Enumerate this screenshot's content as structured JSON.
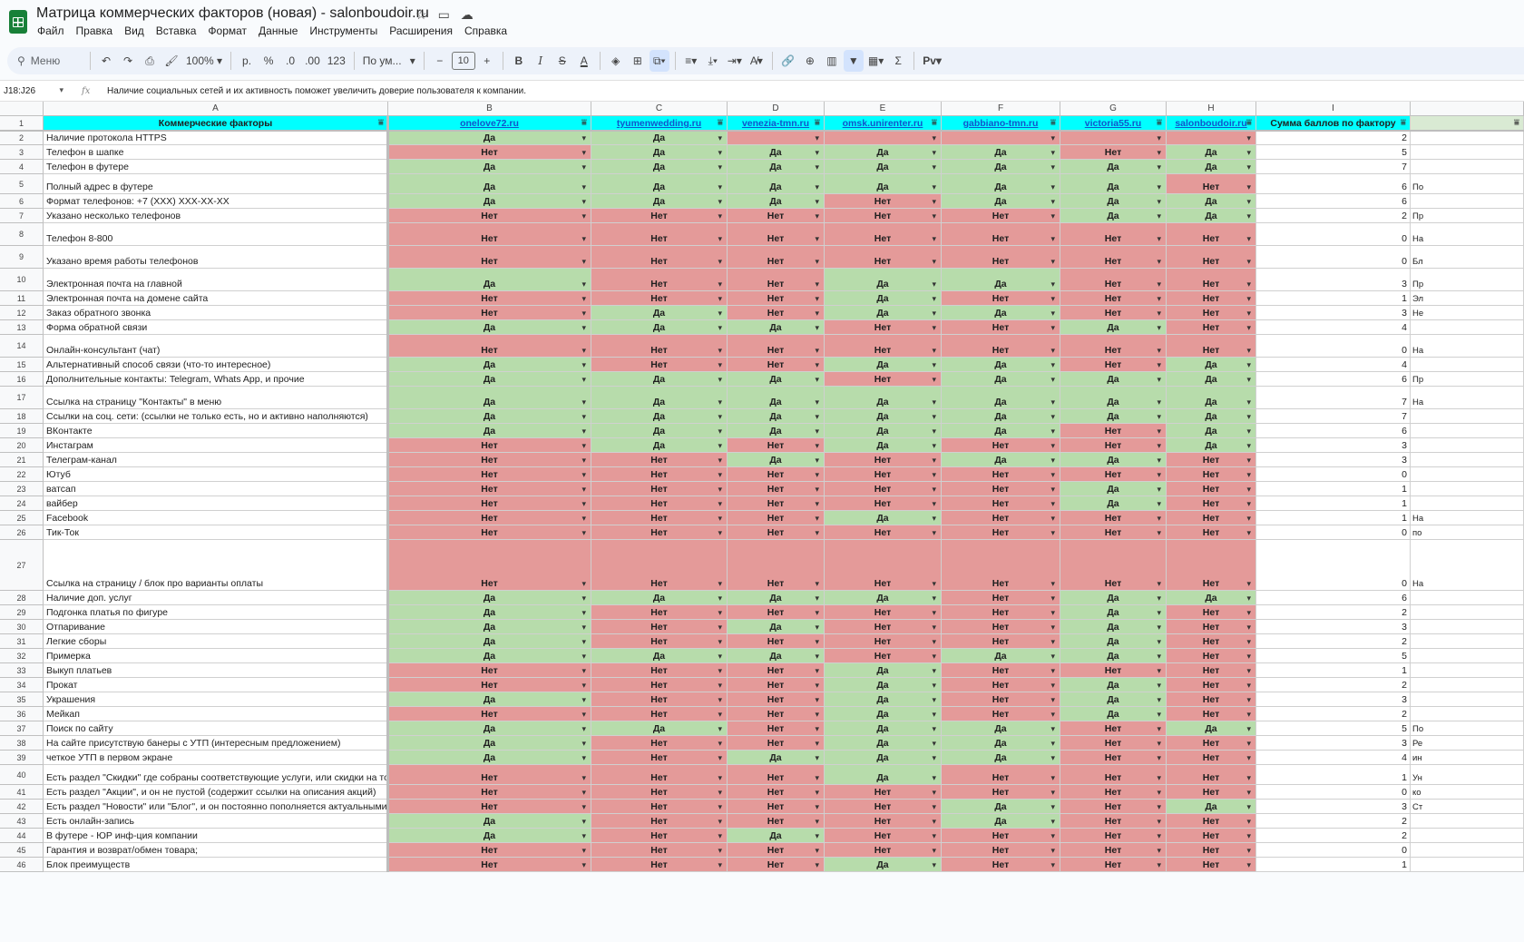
{
  "app": {
    "title": "Матрица коммерческих факторов (новая) - salonboudoir.ru",
    "menu": [
      "Файл",
      "Правка",
      "Вид",
      "Вставка",
      "Формат",
      "Данные",
      "Инструменты",
      "Расширения",
      "Справка"
    ]
  },
  "toolbar": {
    "search_label": "Меню",
    "zoom": "100%",
    "currency": "р.",
    "percent": "%",
    "dec_less": ".0",
    "dec_more": ".00",
    "format_num": "123",
    "font": "По ум...",
    "font_size": "10",
    "bold": "B",
    "italic": "I",
    "strike": "S",
    "text_color": "A",
    "sigma": "Σ",
    "input_tool": "Pv"
  },
  "formula_bar": {
    "name_box": "J18:J26",
    "fx": "fx",
    "content": "Наличие социальных сетей и их активность поможет увеличить доверие пользователя к компании."
  },
  "columns": [
    "",
    "A",
    "B",
    "C",
    "D",
    "E",
    "F",
    "G",
    "H",
    "I"
  ],
  "headers": {
    "factor": "Коммерческие факторы",
    "sites": [
      "onelove72.ru",
      "tyumenwedding.ru",
      "venezia-tmn.ru",
      "omsk.unirenter.ru",
      "gabbiano-tmn.ru",
      "victoria55.ru",
      "salonboudoir.ru"
    ],
    "sum": "Сумма баллов по фактору"
  },
  "rows": [
    {
      "n": "2",
      "f": "Наличие протокола HTTPS",
      "v": [
        "Да",
        "Да",
        "",
        "",
        "",
        "",
        ""
      ],
      "s": "2",
      "j": ""
    },
    {
      "n": "3",
      "f": "Телефон в шапке",
      "v": [
        "Нет",
        "Да",
        "Да",
        "Да",
        "Да",
        "Нет",
        "Да"
      ],
      "s": "5",
      "j": ""
    },
    {
      "n": "4",
      "f": "Телефон в футере",
      "v": [
        "Да",
        "Да",
        "Да",
        "Да",
        "Да",
        "Да",
        "Да"
      ],
      "s": "7",
      "j": ""
    },
    {
      "n": "5",
      "f": "Полный адрес в футере",
      "v": [
        "Да",
        "Да",
        "Да",
        "Да",
        "Да",
        "Да",
        "Нет"
      ],
      "s": "6",
      "j": "По"
    },
    {
      "n": "6",
      "f": "Формат телефонов: +7 (XXX) XXX-XX-XX",
      "v": [
        "Да",
        "Да",
        "Да",
        "Нет",
        "Да",
        "Да",
        "Да"
      ],
      "s": "6",
      "j": ""
    },
    {
      "n": "7",
      "f": "Указано несколько телефонов",
      "v": [
        "Нет",
        "Нет",
        "Нет",
        "Нет",
        "Нет",
        "Да",
        "Да"
      ],
      "s": "2",
      "j": "Пр"
    },
    {
      "n": "8",
      "f": "Телефон 8-800",
      "v": [
        "Нет",
        "Нет",
        "Нет",
        "Нет",
        "Нет",
        "Нет",
        "Нет"
      ],
      "s": "0",
      "j": "На"
    },
    {
      "n": "9",
      "f": "Указано время работы телефонов",
      "v": [
        "Нет",
        "Нет",
        "Нет",
        "Нет",
        "Нет",
        "Нет",
        "Нет"
      ],
      "s": "0",
      "j": "Бл"
    },
    {
      "n": "10",
      "f": "Электронная почта на главной",
      "v": [
        "Да",
        "Нет",
        "Нет",
        "Да",
        "Да",
        "Нет",
        "Нет"
      ],
      "s": "3",
      "j": "Пр"
    },
    {
      "n": "11",
      "f": "Электронная почта на домене сайта",
      "v": [
        "Нет",
        "Нет",
        "Нет",
        "Да",
        "Нет",
        "Нет",
        "Нет"
      ],
      "s": "1",
      "j": "Эл"
    },
    {
      "n": "12",
      "f": "Заказ обратного звонка",
      "v": [
        "Нет",
        "Да",
        "Нет",
        "Да",
        "Да",
        "Нет",
        "Нет"
      ],
      "s": "3",
      "j": "Не"
    },
    {
      "n": "13",
      "f": "Форма обратной связи",
      "v": [
        "Да",
        "Да",
        "Да",
        "Нет",
        "Нет",
        "Да",
        "Нет"
      ],
      "s": "4",
      "j": ""
    },
    {
      "n": "14",
      "f": "Онлайн-консультант (чат)",
      "v": [
        "Нет",
        "Нет",
        "Нет",
        "Нет",
        "Нет",
        "Нет",
        "Нет"
      ],
      "s": "0",
      "j": "На"
    },
    {
      "n": "15",
      "f": "Альтернативный способ связи (что-то интересное)",
      "v": [
        "Да",
        "Нет",
        "Нет",
        "Да",
        "Да",
        "Нет",
        "Да"
      ],
      "s": "4",
      "j": ""
    },
    {
      "n": "16",
      "f": "Дополнительные контакты: Telegram, Whats App, и прочие",
      "v": [
        "Да",
        "Да",
        "Да",
        "Нет",
        "Да",
        "Да",
        "Да"
      ],
      "s": "6",
      "j": "Пр"
    },
    {
      "n": "17",
      "f": "Ссылка на страницу \"Контакты\" в меню",
      "v": [
        "Да",
        "Да",
        "Да",
        "Да",
        "Да",
        "Да",
        "Да"
      ],
      "s": "7",
      "j": "На"
    },
    {
      "n": "18",
      "f": "Ссылки на соц. сети: (ссылки не только есть, но и активно наполняются)",
      "v": [
        "Да",
        "Да",
        "Да",
        "Да",
        "Да",
        "Да",
        "Да"
      ],
      "s": "7",
      "j": ""
    },
    {
      "n": "19",
      "f": "ВКонтакте",
      "v": [
        "Да",
        "Да",
        "Да",
        "Да",
        "Да",
        "Нет",
        "Да"
      ],
      "s": "6",
      "j": ""
    },
    {
      "n": "20",
      "f": "Инстаграм",
      "v": [
        "Нет",
        "Да",
        "Нет",
        "Да",
        "Нет",
        "Нет",
        "Да"
      ],
      "s": "3",
      "j": ""
    },
    {
      "n": "21",
      "f": "Телеграм-канал",
      "v": [
        "Нет",
        "Нет",
        "Да",
        "Нет",
        "Да",
        "Да",
        "Нет"
      ],
      "s": "3",
      "j": ""
    },
    {
      "n": "22",
      "f": "Ютуб",
      "v": [
        "Нет",
        "Нет",
        "Нет",
        "Нет",
        "Нет",
        "Нет",
        "Нет"
      ],
      "s": "0",
      "j": ""
    },
    {
      "n": "23",
      "f": "ватсап",
      "v": [
        "Нет",
        "Нет",
        "Нет",
        "Нет",
        "Нет",
        "Да",
        "Нет"
      ],
      "s": "1",
      "j": ""
    },
    {
      "n": "24",
      "f": "вайбер",
      "v": [
        "Нет",
        "Нет",
        "Нет",
        "Нет",
        "Нет",
        "Да",
        "Нет"
      ],
      "s": "1",
      "j": ""
    },
    {
      "n": "25",
      "f": "Facebook",
      "v": [
        "Нет",
        "Нет",
        "Нет",
        "Да",
        "Нет",
        "Нет",
        "Нет"
      ],
      "s": "1",
      "j": "На"
    },
    {
      "n": "26",
      "f": "Тик-Ток",
      "v": [
        "Нет",
        "Нет",
        "Нет",
        "Нет",
        "Нет",
        "Нет",
        "Нет"
      ],
      "s": "0",
      "j": "по"
    },
    {
      "n": "27",
      "f": "Ссылка на страницу / блок про варианты оплаты",
      "v": [
        "Нет",
        "Нет",
        "Нет",
        "Нет",
        "Нет",
        "Нет",
        "Нет"
      ],
      "s": "0",
      "j": "На"
    },
    {
      "n": "28",
      "f": "Наличие доп. услуг",
      "v": [
        "Да",
        "Да",
        "Да",
        "Да",
        "Нет",
        "Да",
        "Да"
      ],
      "s": "6",
      "j": ""
    },
    {
      "n": "29",
      "f": "Подгонка платья по фигуре",
      "v": [
        "Да",
        "Нет",
        "Нет",
        "Нет",
        "Нет",
        "Да",
        "Нет"
      ],
      "s": "2",
      "j": ""
    },
    {
      "n": "30",
      "f": "Отпаривание",
      "v": [
        "Да",
        "Нет",
        "Да",
        "Нет",
        "Нет",
        "Да",
        "Нет"
      ],
      "s": "3",
      "j": ""
    },
    {
      "n": "31",
      "f": "Легкие сборы",
      "v": [
        "Да",
        "Нет",
        "Нет",
        "Нет",
        "Нет",
        "Да",
        "Нет"
      ],
      "s": "2",
      "j": ""
    },
    {
      "n": "32",
      "f": "Примерка",
      "v": [
        "Да",
        "Да",
        "Да",
        "Нет",
        "Да",
        "Да",
        "Нет"
      ],
      "s": "5",
      "j": ""
    },
    {
      "n": "33",
      "f": "Выкуп платьев",
      "v": [
        "Нет",
        "Нет",
        "Нет",
        "Да",
        "Нет",
        "Нет",
        "Нет"
      ],
      "s": "1",
      "j": ""
    },
    {
      "n": "34",
      "f": "Прокат",
      "v": [
        "Нет",
        "Нет",
        "Нет",
        "Да",
        "Нет",
        "Да",
        "Нет"
      ],
      "s": "2",
      "j": ""
    },
    {
      "n": "35",
      "f": "Украшения",
      "v": [
        "Да",
        "Нет",
        "Нет",
        "Да",
        "Нет",
        "Да",
        "Нет"
      ],
      "s": "3",
      "j": ""
    },
    {
      "n": "36",
      "f": "Мейкап",
      "v": [
        "Нет",
        "Нет",
        "Нет",
        "Да",
        "Нет",
        "Да",
        "Нет"
      ],
      "s": "2",
      "j": ""
    },
    {
      "n": "37",
      "f": "Поиск по сайту",
      "v": [
        "Да",
        "Да",
        "Нет",
        "Да",
        "Да",
        "Нет",
        "Да"
      ],
      "s": "5",
      "j": "По"
    },
    {
      "n": "38",
      "f": "На сайте присутствую банеры с УТП (интересным предложением)",
      "v": [
        "Да",
        "Нет",
        "Нет",
        "Да",
        "Да",
        "Нет",
        "Нет"
      ],
      "s": "3",
      "j": "Ре"
    },
    {
      "n": "39",
      "f": "четкое УТП в первом экране",
      "v": [
        "Да",
        "Нет",
        "Да",
        "Да",
        "Да",
        "Нет",
        "Нет"
      ],
      "s": "4",
      "j": "ин"
    },
    {
      "n": "40",
      "f": "Есть раздел \"Скидки\" где собраны соответствующие услуги, или скидки на това",
      "v": [
        "Нет",
        "Нет",
        "Нет",
        "Да",
        "Нет",
        "Нет",
        "Нет"
      ],
      "s": "1",
      "j": "Ун"
    },
    {
      "n": "41",
      "f": "Есть раздел \"Акции\", и он не пустой (содержит ссылки на описания акций)",
      "v": [
        "Нет",
        "Нет",
        "Нет",
        "Нет",
        "Нет",
        "Нет",
        "Нет"
      ],
      "s": "0",
      "j": "ко"
    },
    {
      "n": "42",
      "f": "Есть раздел \"Новости\" или \"Блог\", и он постоянно пополняется актуальными н",
      "v": [
        "Нет",
        "Нет",
        "Нет",
        "Нет",
        "Да",
        "Нет",
        "Да"
      ],
      "s": "3",
      "j": "Ст"
    },
    {
      "n": "43",
      "f": "Есть онлайн-запись",
      "v": [
        "Да",
        "Нет",
        "Нет",
        "Нет",
        "Да",
        "Нет",
        "Нет"
      ],
      "s": "2",
      "j": ""
    },
    {
      "n": "44",
      "f": "В футере - ЮР инф-ция компании",
      "v": [
        "Да",
        "Нет",
        "Да",
        "Нет",
        "Нет",
        "Нет",
        "Нет"
      ],
      "s": "2",
      "j": ""
    },
    {
      "n": "45",
      "f": "Гарантия и возврат/обмен товара;",
      "v": [
        "Нет",
        "Нет",
        "Нет",
        "Нет",
        "Нет",
        "Нет",
        "Нет"
      ],
      "s": "0",
      "j": ""
    },
    {
      "n": "46",
      "f": "Блок преимуществ",
      "v": [
        "Нет",
        "Нет",
        "Нет",
        "Да",
        "Нет",
        "Нет",
        "Нет"
      ],
      "s": "1",
      "j": ""
    }
  ],
  "colors": {
    "yes": "#b7dcab",
    "no": "#e49a99",
    "header_bg": "#00ffff",
    "link": "#1155cc"
  }
}
